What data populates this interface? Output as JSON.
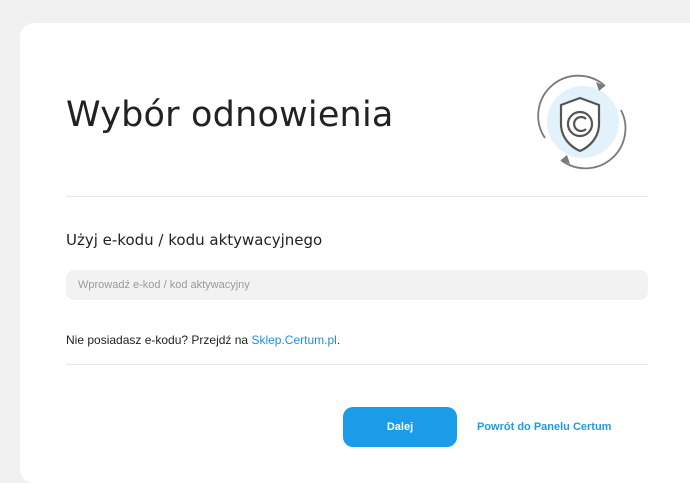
{
  "page": {
    "title": "Wybór odnowienia",
    "logo_icon": "certum-shield-renew-icon"
  },
  "form": {
    "section_label": "Użyj e-kodu / kodu aktywacyjnego",
    "code_input_placeholder": "Wprowadź e-kod / kod aktywacyjny",
    "code_input_value": "",
    "hint_text": "Nie posiadasz e-kodu? Przejdź na ",
    "hint_link": "Sklep.Certum.pl",
    "hint_suffix": "."
  },
  "actions": {
    "next_label": "Dalej",
    "back_label": "Powrót do Panelu Certum"
  },
  "colors": {
    "accent": "#1a9ce9",
    "link": "#1f8de6",
    "input_bg": "#f2f2f2"
  }
}
